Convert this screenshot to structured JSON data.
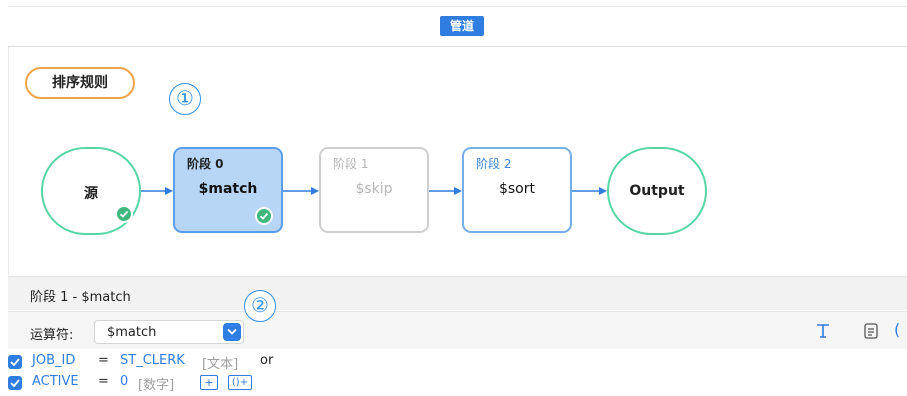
{
  "header": {
    "tab_label": "管道"
  },
  "canvas": {
    "sort_rule_label": "排序规则",
    "marker_1": "①",
    "source": {
      "label": "源",
      "status": "check-icon"
    },
    "stages": [
      {
        "title": "阶段 0",
        "name": "$match",
        "state": "selected",
        "status": "check-icon"
      },
      {
        "title": "阶段 1",
        "name": "$skip",
        "state": "disabled"
      },
      {
        "title": "阶段 2",
        "name": "$sort",
        "state": "normal"
      }
    ],
    "output": {
      "label": "Output"
    }
  },
  "panel": {
    "title": "阶段 1 - $match",
    "marker_2": "②",
    "operator_label": "运算符:",
    "operator_value": "$match",
    "tools": [
      "text-format-icon",
      "document-icon",
      "paren-icon"
    ]
  },
  "conditions": [
    {
      "checked": true,
      "field": "JOB_ID",
      "op": "=",
      "value": "ST_CLERK",
      "type": "[文本]",
      "conj": "or"
    },
    {
      "checked": true,
      "field": "ACTIVE",
      "op": "=",
      "value": "0",
      "type": "[数字]",
      "buttons": [
        "+",
        "()+"
      ]
    }
  ],
  "colors": {
    "accent": "#2f7de1",
    "source_border": "#56d6a4",
    "rule_chip": "#f0a449",
    "check": "#3fb77f"
  }
}
